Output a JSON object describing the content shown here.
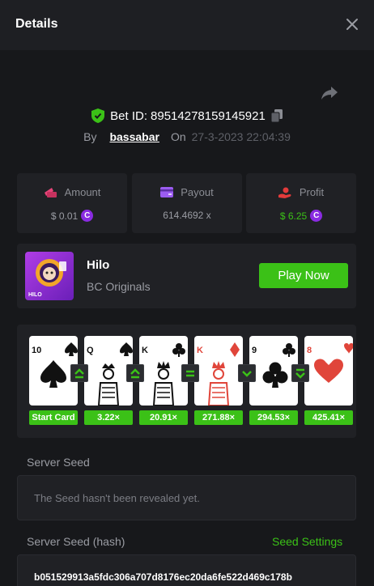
{
  "header": {
    "title": "Details",
    "close_icon": "close-icon"
  },
  "bet": {
    "label": "Bet ID:",
    "id": "89514278159145921",
    "by_label": "By",
    "user": "bassabar",
    "on_label": "On",
    "datetime": "27-3-2023 22:04:39"
  },
  "stats": {
    "amount": {
      "label": "Amount",
      "value": "$ 0.01",
      "icon": "wallet-icon",
      "color": "#e8457a"
    },
    "payout": {
      "label": "Payout",
      "value": "614.4692 x",
      "icon": "payout-icon",
      "color": "#9b5cf0"
    },
    "profit": {
      "label": "Profit",
      "value": "$ 6.25",
      "icon": "profit-icon",
      "color": "#e23b3b"
    }
  },
  "game": {
    "name": "Hilo",
    "category": "BC Originals",
    "play_label": "Play Now",
    "thumb_label": "HILO"
  },
  "cards": [
    {
      "rank": "10",
      "suit": "spades",
      "color": "black",
      "multiplier": "Start Card"
    },
    {
      "rank": "Q",
      "suit": "spades",
      "color": "black",
      "multiplier": "3.22×"
    },
    {
      "rank": "K",
      "suit": "clubs",
      "color": "black",
      "multiplier": "20.91×"
    },
    {
      "rank": "K",
      "suit": "diamonds",
      "color": "red",
      "multiplier": "271.88×"
    },
    {
      "rank": "9",
      "suit": "clubs",
      "color": "black",
      "multiplier": "294.53×"
    },
    {
      "rank": "8",
      "suit": "hearts",
      "color": "red",
      "multiplier": "425.41×"
    }
  ],
  "guesses": [
    "higher-or-same-icon",
    "higher-or-same-icon",
    "same-icon",
    "lower-icon",
    "lower-or-same-icon"
  ],
  "server_seed": {
    "label": "Server Seed",
    "placeholder": "The Seed hasn't been revealed yet."
  },
  "server_seed_hash": {
    "label": "Server Seed (hash)",
    "settings_label": "Seed Settings",
    "value": "b051529913a5fdc306a707d8176ec20da6fe522d469c178b"
  },
  "colors": {
    "accent": "#3bc117",
    "background": "#17181b",
    "panel": "#202125",
    "coin": "#8a2be2"
  }
}
